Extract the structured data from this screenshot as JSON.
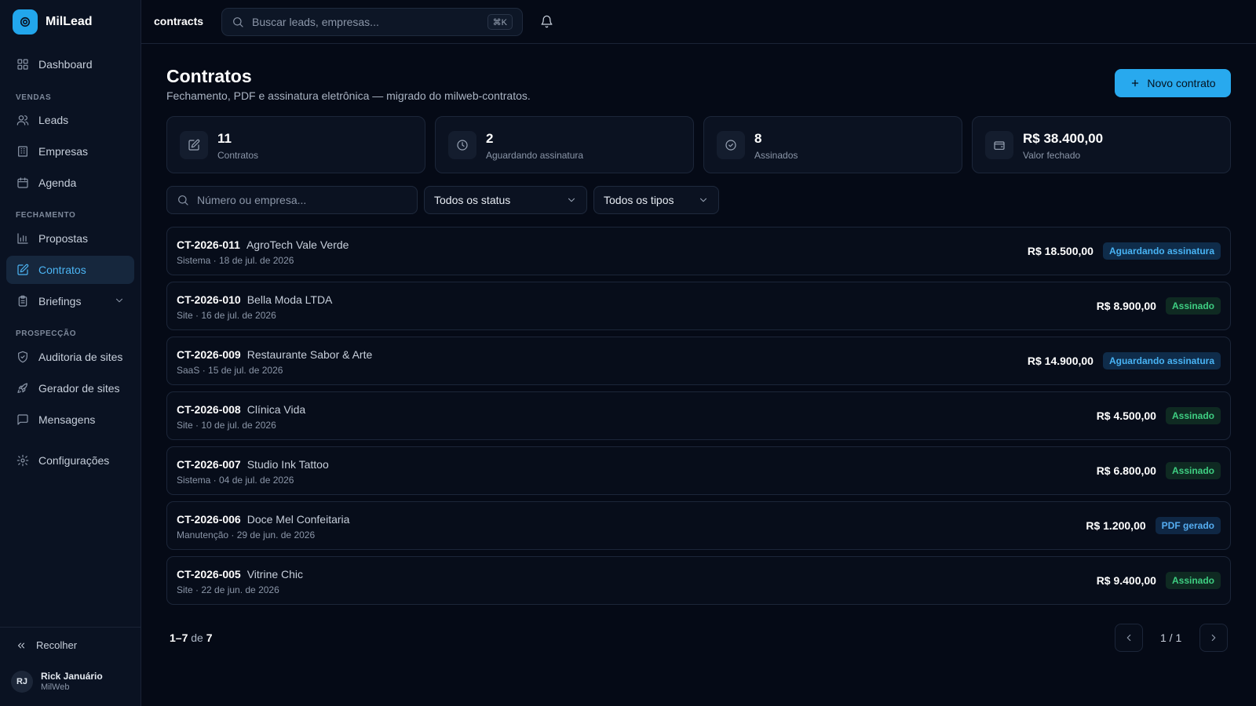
{
  "app": {
    "name": "MilLead",
    "accent": "#28a9ee"
  },
  "sidebar": {
    "dashboard": "Dashboard",
    "sections": {
      "vendas": "VENDAS",
      "fechamento": "FECHAMENTO",
      "prospeccao": "PROSPECÇÃO"
    },
    "items": {
      "leads": "Leads",
      "empresas": "Empresas",
      "agenda": "Agenda",
      "propostas": "Propostas",
      "contratos": "Contratos",
      "briefings": "Briefings",
      "auditoria": "Auditoria de sites",
      "gerador": "Gerador de sites",
      "mensagens": "Mensagens",
      "configuracoes": "Configurações"
    },
    "active": "Contratos",
    "collapse": "Recolher",
    "user": {
      "initials": "RJ",
      "name": "Rick Januário",
      "org": "MilWeb"
    }
  },
  "topbar": {
    "breadcrumb": "contracts",
    "search_placeholder": "Buscar leads, empresas...",
    "shortcut": "⌘K"
  },
  "page": {
    "title": "Contratos",
    "subtitle": "Fechamento, PDF e assinatura eletrônica — migrado do milweb-contratos.",
    "new_button": "Novo contrato"
  },
  "stats": [
    {
      "value": "11",
      "label": "Contratos",
      "icon": "contract-icon"
    },
    {
      "value": "2",
      "label": "Aguardando assinatura",
      "icon": "clock-icon"
    },
    {
      "value": "8",
      "label": "Assinados",
      "icon": "check-circle-icon"
    },
    {
      "value": "R$ 38.400,00",
      "label": "Valor fechado",
      "icon": "wallet-icon"
    }
  ],
  "filters": {
    "search_placeholder": "Número ou empresa...",
    "status": "Todos os status",
    "type": "Todos os tipos"
  },
  "contracts": [
    {
      "number": "CT-2026-011",
      "company": "AgroTech Vale Verde",
      "meta": "Sistema · 18 de jul. de 2026",
      "value": "R$ 18.500,00",
      "status": "Aguardando assinatura"
    },
    {
      "number": "CT-2026-010",
      "company": "Bella Moda LTDA",
      "meta": "Site · 16 de jul. de 2026",
      "value": "R$ 8.900,00",
      "status": "Assinado"
    },
    {
      "number": "CT-2026-009",
      "company": "Restaurante Sabor & Arte",
      "meta": "SaaS · 15 de jul. de 2026",
      "value": "R$ 14.900,00",
      "status": "Aguardando assinatura"
    },
    {
      "number": "CT-2026-008",
      "company": "Clínica Vida",
      "meta": "Site · 10 de jul. de 2026",
      "value": "R$ 4.500,00",
      "status": "Assinado"
    },
    {
      "number": "CT-2026-007",
      "company": "Studio Ink Tattoo",
      "meta": "Sistema · 04 de jul. de 2026",
      "value": "R$ 6.800,00",
      "status": "Assinado"
    },
    {
      "number": "CT-2026-006",
      "company": "Doce Mel Confeitaria",
      "meta": "Manutenção · 29 de jun. de 2026",
      "value": "R$ 1.200,00",
      "status": "PDF gerado"
    },
    {
      "number": "CT-2026-005",
      "company": "Vitrine Chic",
      "meta": "Site · 22 de jun. de 2026",
      "value": "R$ 9.400,00",
      "status": "Assinado"
    }
  ],
  "pagination": {
    "range": "1–7",
    "of": "de",
    "total": "7",
    "page": "1 / 1"
  }
}
